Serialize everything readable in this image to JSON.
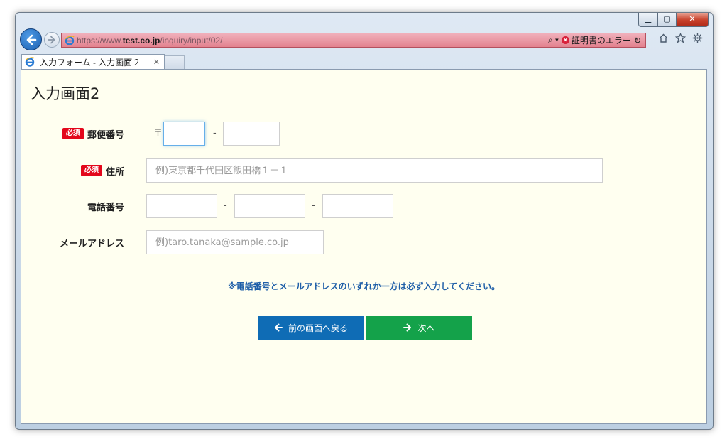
{
  "browser": {
    "url_prefix": "https://www.",
    "url_host": "test.co.jp",
    "url_path": "/inquiry/input/02/",
    "search_glyph": "⌕ ▾",
    "cert_error": "証明書のエラー",
    "refresh_glyph": "↻",
    "tab_title": "入力フォーム - 入力画面２",
    "tab_close": "✕",
    "controls": {
      "minimize": "▁",
      "maximize": "▢",
      "close": "✕"
    }
  },
  "page": {
    "title": "入力画面2",
    "required_badge": "必須",
    "postal": {
      "label": "郵便番号",
      "symbol": "〒",
      "separator": "-",
      "part1_value": "",
      "part2_value": ""
    },
    "address": {
      "label": "住所",
      "placeholder": "例)東京都千代田区飯田橋１－１",
      "value": ""
    },
    "phone": {
      "label": "電話番号",
      "separator": "-",
      "part1_value": "",
      "part2_value": "",
      "part3_value": ""
    },
    "email": {
      "label": "メールアドレス",
      "placeholder": "例)taro.tanaka@sample.co.jp",
      "value": ""
    },
    "notice": "※電話番号とメールアドレスのいずれか一方は必ず入力してください。",
    "buttons": {
      "back_label": "前の画面へ戻る",
      "next_label": "次へ"
    }
  },
  "colors": {
    "address_bar_error": "#e3828f",
    "content_bg": "#fffff0",
    "required_badge": "#e3071b",
    "notice_text": "#1f5fa8",
    "back_button": "#0f6cb5",
    "next_button": "#14a24a"
  },
  "icons": [
    "back-arrow-icon",
    "forward-arrow-icon",
    "ie-logo-icon",
    "search-icon",
    "certificate-error-icon",
    "refresh-icon",
    "home-icon",
    "favorites-star-icon",
    "settings-gear-icon",
    "arrow-left-icon",
    "arrow-right-icon"
  ]
}
